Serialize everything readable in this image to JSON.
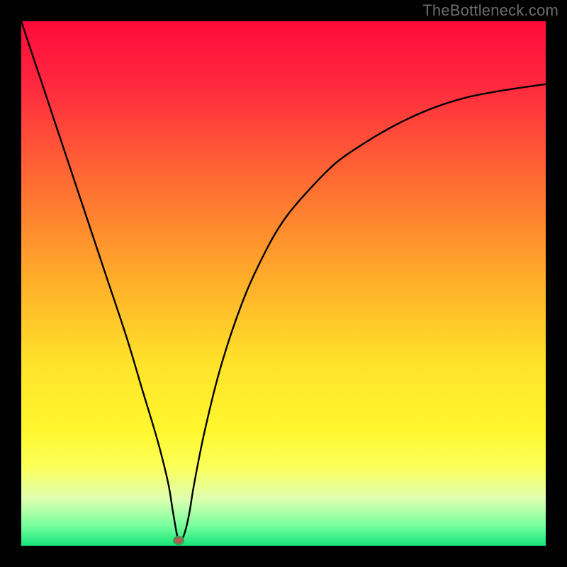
{
  "watermark": "TheBottleneck.com",
  "colors": {
    "frame": "#000000",
    "watermark": "#6b6b6b",
    "curve": "#000000",
    "marker_fill": "#b35a55",
    "marker_stroke": "#2aa84a",
    "gradient_stops": [
      {
        "pct": 0,
        "c": "#ff0b3a"
      },
      {
        "pct": 12,
        "c": "#ff283f"
      },
      {
        "pct": 30,
        "c": "#ff6a33"
      },
      {
        "pct": 50,
        "c": "#ffb02a"
      },
      {
        "pct": 65,
        "c": "#ffe22a"
      },
      {
        "pct": 78,
        "c": "#fff72e"
      },
      {
        "pct": 85,
        "c": "#fcff5a"
      },
      {
        "pct": 91,
        "c": "#dfffb0"
      },
      {
        "pct": 96,
        "c": "#7bff9e"
      },
      {
        "pct": 100,
        "c": "#17e57d"
      }
    ]
  },
  "chart_data": {
    "type": "line",
    "title": "",
    "xlabel": "",
    "ylabel": "",
    "xlim": [
      0,
      100
    ],
    "ylim": [
      0,
      100
    ],
    "legend": false,
    "grid": false,
    "series": [
      {
        "name": "bottleneck-curve",
        "x": [
          0,
          4,
          8,
          12,
          16,
          20,
          23,
          26,
          28,
          29,
          30,
          31,
          32,
          33,
          35,
          38,
          42,
          46,
          50,
          55,
          60,
          65,
          70,
          75,
          80,
          85,
          90,
          95,
          100
        ],
        "y": [
          100,
          88,
          76,
          64,
          52,
          40,
          30,
          20,
          12,
          6,
          1,
          2,
          6,
          12,
          22,
          34,
          46,
          55,
          62,
          68,
          73,
          76.5,
          79.5,
          82,
          84,
          85.5,
          86.5,
          87.3,
          88
        ]
      }
    ],
    "markers": [
      {
        "name": "min-point",
        "x": 30,
        "y": 1
      }
    ]
  }
}
